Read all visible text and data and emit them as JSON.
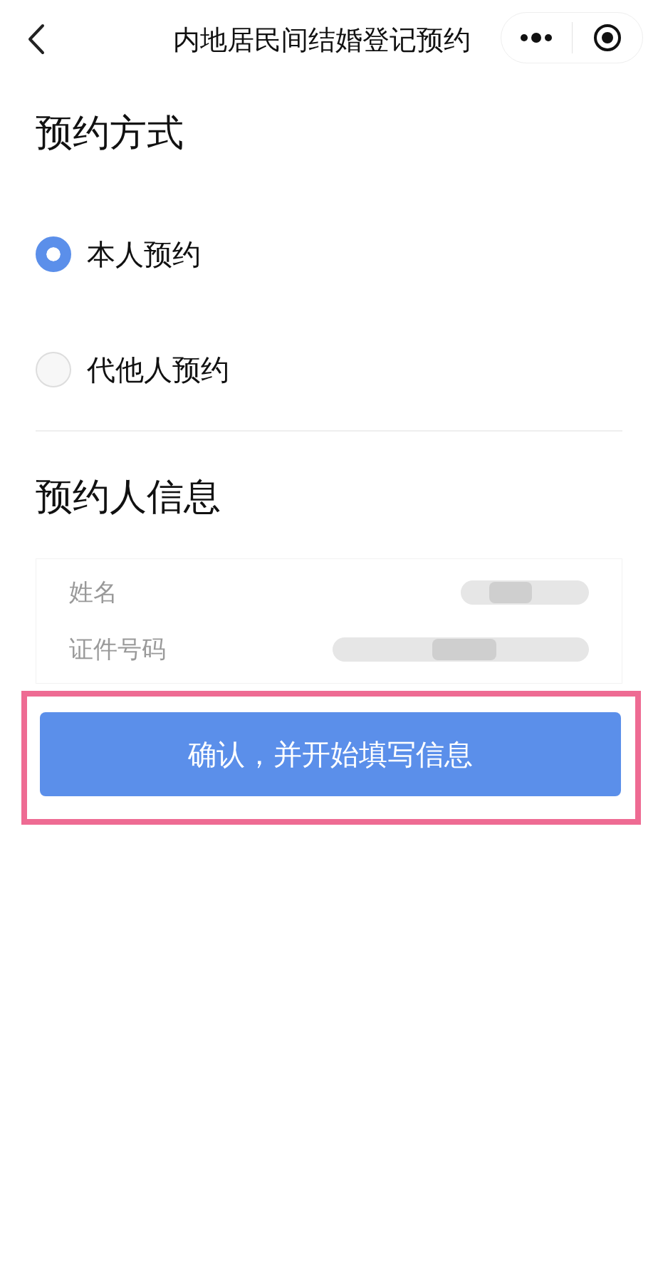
{
  "nav_bar": {
    "title": "内地居民间结婚登记预约"
  },
  "booking_method": {
    "title": "预约方式",
    "options": [
      {
        "label": "本人预约",
        "selected": true
      },
      {
        "label": "代他人预约",
        "selected": false
      }
    ]
  },
  "applicant_info": {
    "title": "预约人信息",
    "fields": [
      {
        "label": "姓名",
        "redacted": true
      },
      {
        "label": "证件号码",
        "redacted": true
      }
    ]
  },
  "confirm_button": {
    "label": "确认，并开始填写信息",
    "highlighted": true
  }
}
